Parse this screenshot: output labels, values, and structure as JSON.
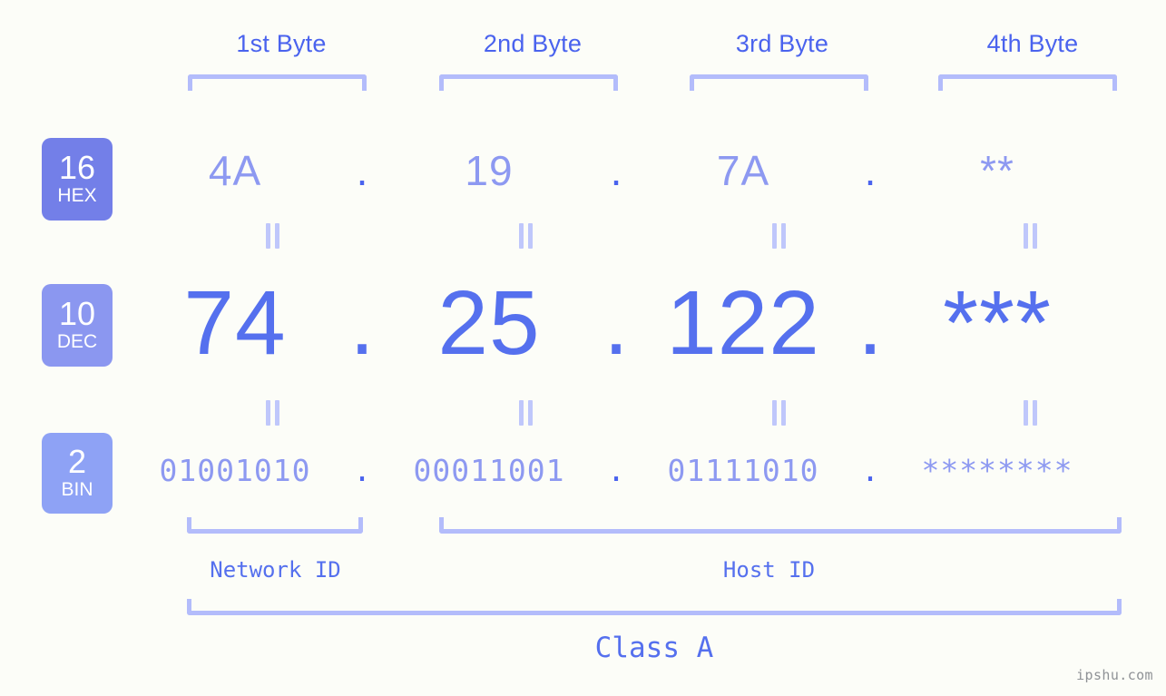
{
  "watermark": "ipshu.com",
  "byte_headers": [
    {
      "label": "1st Byte"
    },
    {
      "label": "2nd Byte"
    },
    {
      "label": "3rd Byte"
    },
    {
      "label": "4th Byte"
    }
  ],
  "bases": [
    {
      "number": "16",
      "name": "HEX",
      "color": "#737fe8"
    },
    {
      "number": "10",
      "name": "DEC",
      "color": "#8b97f0"
    },
    {
      "number": "2",
      "name": "BIN",
      "color": "#8ea2f5"
    }
  ],
  "separator": ".",
  "rows": {
    "hex": {
      "base_number": "16",
      "base_name": "HEX",
      "values": [
        "4A",
        "19",
        "7A",
        "**"
      ]
    },
    "dec": {
      "base_number": "10",
      "base_name": "DEC",
      "values": [
        "74",
        "25",
        "122",
        "***"
      ]
    },
    "bin": {
      "base_number": "2",
      "base_name": "BIN",
      "values": [
        "01001010",
        "00011001",
        "01111010",
        "********"
      ]
    }
  },
  "segments": {
    "network_id": "Network ID",
    "host_id": "Host ID"
  },
  "class": {
    "label": "Class A"
  },
  "colors": {
    "background": "#fcfdf8",
    "accent_strong": "#4a63ee",
    "accent_mid": "#5570ee",
    "accent_light": "#8d99f1",
    "bracket": "#b3bcfb",
    "equals": "#bfc7fb",
    "watermark": "#8f9296"
  }
}
